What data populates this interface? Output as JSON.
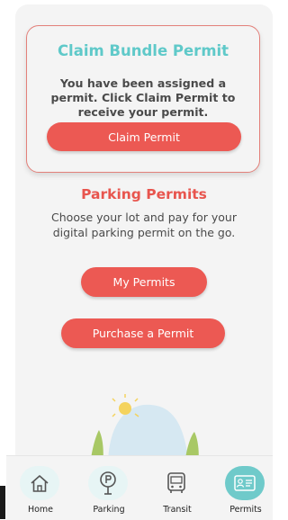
{
  "bundle": {
    "title": "Claim Bundle Permit",
    "message": "You have been assigned a permit. Click Claim Permit to receive your permit.",
    "claim_button": "Claim Permit"
  },
  "parking": {
    "title": "Parking Permits",
    "description": "Choose your lot and pay for your digital parking permit on the go.",
    "my_permits_button": "My Permits",
    "purchase_button": "Purchase a Permit"
  },
  "tabs": [
    {
      "label": "Home",
      "icon": "home-icon",
      "active": false
    },
    {
      "label": "Parking",
      "icon": "parking-meter-icon",
      "active": false
    },
    {
      "label": "Transit",
      "icon": "bus-icon",
      "active": false
    },
    {
      "label": "Permits",
      "icon": "permit-card-icon",
      "active": true
    }
  ],
  "colors": {
    "accent_red": "#ec5953",
    "accent_teal": "#6fcaca",
    "title_teal": "#5fc9c9"
  }
}
